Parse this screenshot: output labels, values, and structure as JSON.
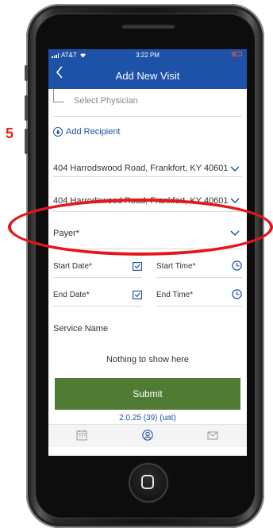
{
  "annotation": {
    "step_number": "5",
    "highlight_color": "#e5161c"
  },
  "status_bar": {
    "carrier": "AT&T",
    "time": "3:22 PM",
    "battery_color": "#e85050"
  },
  "header": {
    "title": "Add New Visit",
    "background_color": "#1d52a8",
    "back_icon": "chevron-left-icon"
  },
  "form": {
    "physician_placeholder": "Select Physician",
    "add_recipient_label": "Add Recipient",
    "address_1": "404 Harrodswood Road, Frankfort, KY 40601",
    "address_2": "404 Harrodswood Road, Frankfort, KY 40601",
    "payer_label": "Payer*",
    "start_date_label": "Start Date*",
    "start_time_label": "Start Time*",
    "end_date_label": "End Date*",
    "end_time_label": "End Time*",
    "service_name_label": "Service Name",
    "empty_message": "Nothing to show here",
    "submit_label": "Submit",
    "submit_color": "#4f7b34"
  },
  "footer": {
    "version": "2.0.25 (39) (uat)"
  },
  "tab_bar": {
    "tabs": [
      "calendar-icon",
      "user-circle-icon",
      "mail-icon"
    ]
  }
}
